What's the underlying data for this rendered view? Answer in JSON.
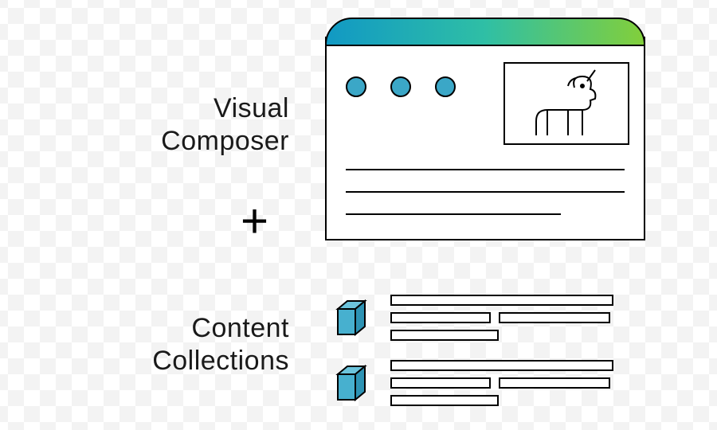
{
  "labels": {
    "visual_composer_line1": "Visual",
    "visual_composer_line2": "Composer",
    "plus": "+",
    "content_collections_line1": "Content",
    "content_collections_line2": "Collections"
  },
  "window": {
    "dots": [
      "dot",
      "dot",
      "dot"
    ],
    "hero_image": "unicorn-icon"
  },
  "collections": [
    {
      "cube": "cube-icon"
    },
    {
      "cube": "cube-icon"
    }
  ]
}
